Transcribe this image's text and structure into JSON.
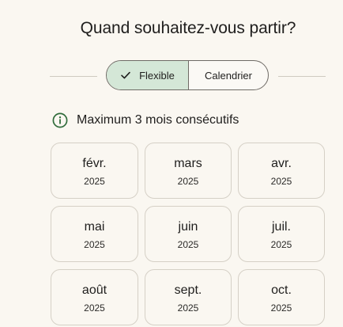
{
  "header": {
    "title": "Quand souhaitez-vous partir?"
  },
  "toggle": {
    "options": [
      {
        "label": "Flexible",
        "selected": true
      },
      {
        "label": "Calendrier",
        "selected": false
      }
    ]
  },
  "info": {
    "text": "Maximum 3 mois consécutifs",
    "icon": "info-icon"
  },
  "months": [
    {
      "name": "févr.",
      "year": "2025"
    },
    {
      "name": "mars",
      "year": "2025"
    },
    {
      "name": "avr.",
      "year": "2025"
    },
    {
      "name": "mai",
      "year": "2025"
    },
    {
      "name": "juin",
      "year": "2025"
    },
    {
      "name": "juil.",
      "year": "2025"
    },
    {
      "name": "août",
      "year": "2025"
    },
    {
      "name": "sept.",
      "year": "2025"
    },
    {
      "name": "oct.",
      "year": "2025"
    }
  ],
  "colors": {
    "background": "#faf7f1",
    "selected_bg": "#d4e7d7",
    "accent_green": "#2f6b3a",
    "border": "#d5d0c6"
  }
}
